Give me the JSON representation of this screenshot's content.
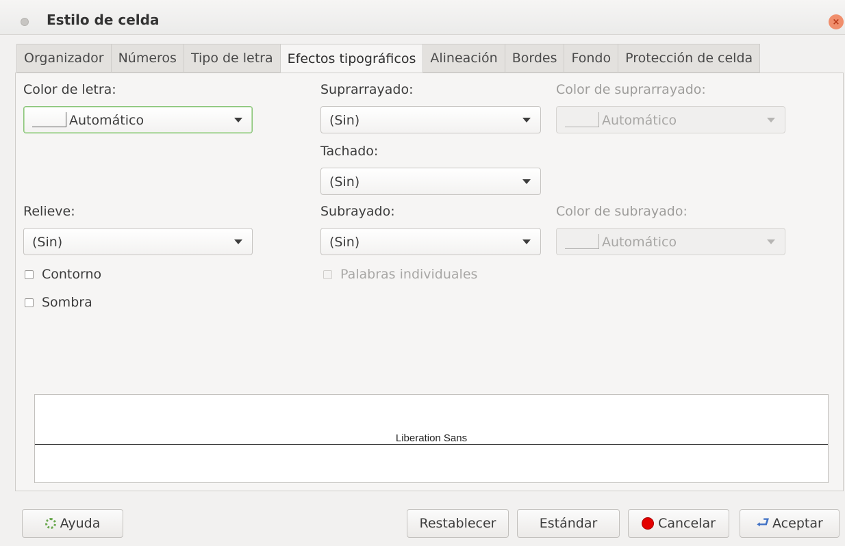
{
  "window": {
    "title": "Estilo de celda"
  },
  "tabs": [
    {
      "label": "Organizador"
    },
    {
      "label": "Números"
    },
    {
      "label": "Tipo de letra"
    },
    {
      "label": "Efectos tipográficos"
    },
    {
      "label": "Alineación"
    },
    {
      "label": "Bordes"
    },
    {
      "label": "Fondo"
    },
    {
      "label": "Protección de celda"
    }
  ],
  "active_tab": "Efectos tipográficos",
  "font_color": {
    "label": "Color de letra:",
    "value": "Automático"
  },
  "overline": {
    "label": "Suprarrayado:",
    "value": "(Sin)"
  },
  "overline_color": {
    "label": "Color de suprarrayado:",
    "value": "Automático"
  },
  "strikethrough": {
    "label": "Tachado:",
    "value": "(Sin)"
  },
  "relief": {
    "label": "Relieve:",
    "value": "(Sin)"
  },
  "underline": {
    "label": "Subrayado:",
    "value": "(Sin)"
  },
  "underline_color": {
    "label": "Color de subrayado:",
    "value": "Automático"
  },
  "checks": {
    "outline": "Contorno",
    "shadow": "Sombra",
    "individual_words": "Palabras individuales"
  },
  "preview": {
    "sample_text": "Liberation Sans"
  },
  "buttons": {
    "help": "Ayuda",
    "reset": "Restablecer",
    "standard": "Estándar",
    "cancel": "Cancelar",
    "ok": "Aceptar"
  },
  "icons": {
    "help": "help-icon",
    "cancel": "cancel-icon",
    "ok": "ok-icon",
    "close": "close-icon"
  },
  "colors": {
    "focus_ring": "#8bc57a",
    "close_button": "#f08e6c",
    "cancel_icon": "#e30000"
  }
}
